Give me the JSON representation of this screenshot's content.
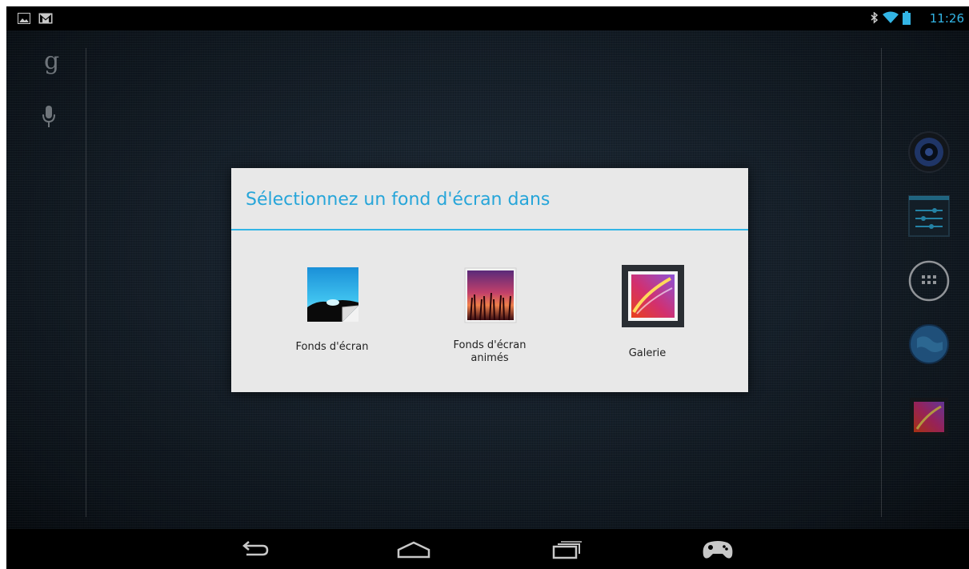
{
  "status_bar": {
    "time": "11:26",
    "left_icons": [
      "image-notification-icon",
      "gmail-icon"
    ],
    "right_icons": [
      "bluetooth-icon",
      "wifi-icon",
      "battery-icon"
    ]
  },
  "dialog": {
    "title": "Sélectionnez un fond d'écran dans",
    "options": [
      {
        "label": "Fonds d'écran",
        "icon": "wallpapers-app-icon"
      },
      {
        "label_line1": "Fonds d'écran",
        "label_line2": "animés",
        "icon": "live-wallpapers-app-icon"
      },
      {
        "label": "Galerie",
        "icon": "gallery-app-icon"
      }
    ]
  },
  "colors": {
    "accent": "#33b5e5",
    "title": "#26a5d9",
    "dialog_bg": "#e8e8e8"
  },
  "left_rail_icons": [
    "google-search-icon",
    "voice-search-icon"
  ],
  "right_rail_icons": [
    "speaker-app-icon",
    "settings-app-icon",
    "all-apps-icon",
    "browser-globe-icon",
    "gallery-shortcut-icon"
  ],
  "nav_bar": [
    "back-icon",
    "home-icon",
    "recent-apps-icon",
    "game-controller-icon"
  ]
}
